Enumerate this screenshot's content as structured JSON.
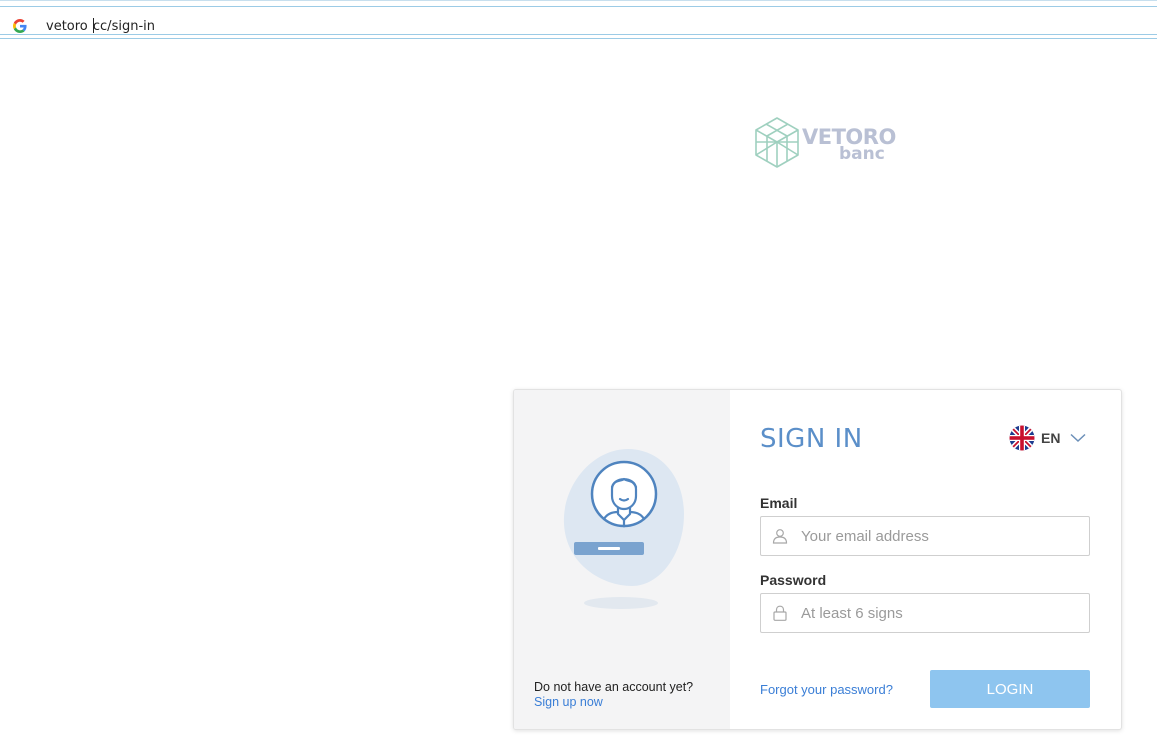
{
  "browser": {
    "url_before_caret": "vetoro ",
    "url_after_caret": "cc/sign-in"
  },
  "logo": {
    "line1": "VETORO",
    "line2": "banc"
  },
  "login_card": {
    "signup_prompt": "Do not have an account yet?",
    "signup_link": "Sign up now",
    "title": "SIGN IN",
    "language": {
      "code": "EN",
      "flag": "uk-flag-icon"
    },
    "email": {
      "label": "Email",
      "placeholder": "Your email address",
      "value": ""
    },
    "password": {
      "label": "Password",
      "placeholder": "At least 6 signs",
      "value": ""
    },
    "forgot_link": "Forgot your password?",
    "login_button": "LOGIN"
  },
  "colors": {
    "accent_blue": "#5b8fc9",
    "link_blue": "#3a7ed6",
    "button_blue": "#8ec5ef",
    "panel_gray": "#f4f4f5",
    "logo_green": "#9fd0bf",
    "logo_gray": "#b9c0d4"
  },
  "icons": [
    "google-icon",
    "vetoro-logo-icon",
    "user-avatar-icon",
    "uk-flag-icon",
    "chevron-down-icon",
    "user-icon",
    "lock-icon"
  ]
}
